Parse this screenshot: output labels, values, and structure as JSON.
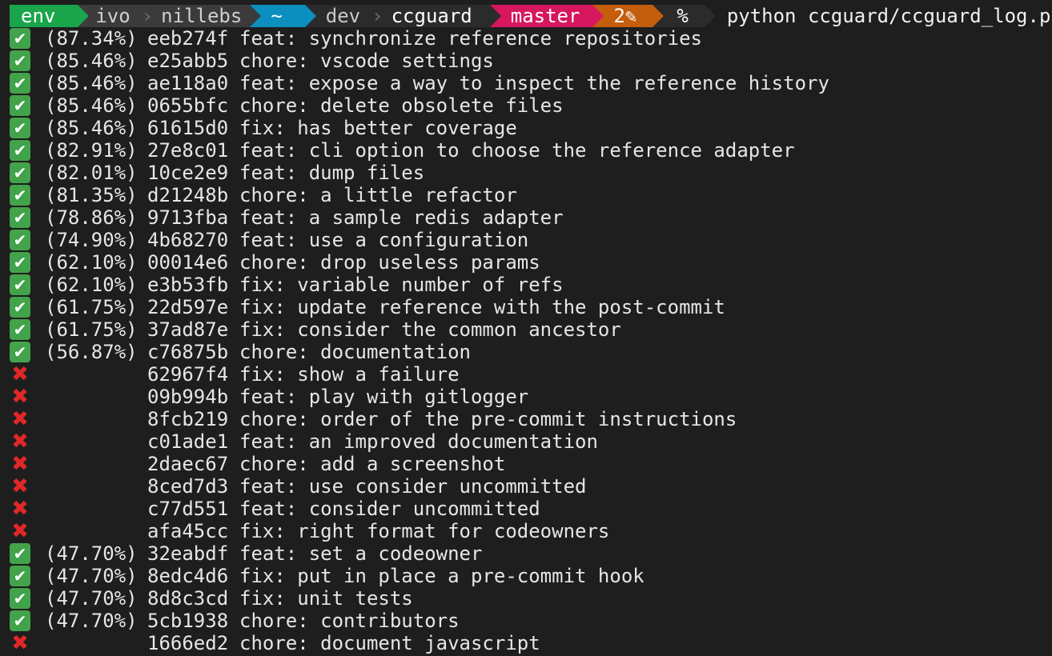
{
  "prompt": {
    "env": "env",
    "user": "ivo",
    "host": "nillebs",
    "home": "~",
    "path_parent": "dev",
    "path_current": "ccguard",
    "branch": "master",
    "changes": "2✎",
    "symbol": "%",
    "command": "python ccguard/ccguard_log.py",
    "colors": {
      "env": "#1aa54a",
      "home": "#0a8fbe",
      "branch": "#d6175d",
      "changes": "#c45d0c"
    }
  },
  "log": {
    "rows": [
      {
        "status": "pass",
        "coverage": "(87.34%)",
        "hash": "eeb274f",
        "message": "feat: synchronize reference repositories"
      },
      {
        "status": "pass",
        "coverage": "(85.46%)",
        "hash": "e25abb5",
        "message": "chore: vscode settings"
      },
      {
        "status": "pass",
        "coverage": "(85.46%)",
        "hash": "ae118a0",
        "message": "feat: expose a way to inspect the reference history"
      },
      {
        "status": "pass",
        "coverage": "(85.46%)",
        "hash": "0655bfc",
        "message": "chore: delete obsolete files"
      },
      {
        "status": "pass",
        "coverage": "(85.46%)",
        "hash": "61615d0",
        "message": "fix: has better coverage"
      },
      {
        "status": "pass",
        "coverage": "(82.91%)",
        "hash": "27e8c01",
        "message": "feat: cli option to choose the reference adapter"
      },
      {
        "status": "pass",
        "coverage": "(82.01%)",
        "hash": "10ce2e9",
        "message": "feat: dump files"
      },
      {
        "status": "pass",
        "coverage": "(81.35%)",
        "hash": "d21248b",
        "message": "chore: a little refactor"
      },
      {
        "status": "pass",
        "coverage": "(78.86%)",
        "hash": "9713fba",
        "message": "feat: a sample redis adapter"
      },
      {
        "status": "pass",
        "coverage": "(74.90%)",
        "hash": "4b68270",
        "message": "feat: use a configuration"
      },
      {
        "status": "pass",
        "coverage": "(62.10%)",
        "hash": "00014e6",
        "message": "chore: drop useless params"
      },
      {
        "status": "pass",
        "coverage": "(62.10%)",
        "hash": "e3b53fb",
        "message": "fix: variable number of refs"
      },
      {
        "status": "pass",
        "coverage": "(61.75%)",
        "hash": "22d597e",
        "message": "fix: update reference with the post-commit"
      },
      {
        "status": "pass",
        "coverage": "(61.75%)",
        "hash": "37ad87e",
        "message": "fix: consider the common ancestor"
      },
      {
        "status": "pass",
        "coverage": "(56.87%)",
        "hash": "c76875b",
        "message": "chore: documentation"
      },
      {
        "status": "fail",
        "coverage": "",
        "hash": "62967f4",
        "message": "fix: show a failure"
      },
      {
        "status": "fail",
        "coverage": "",
        "hash": "09b994b",
        "message": "feat: play with gitlogger"
      },
      {
        "status": "fail",
        "coverage": "",
        "hash": "8fcb219",
        "message": "chore: order of the pre-commit instructions"
      },
      {
        "status": "fail",
        "coverage": "",
        "hash": "c01ade1",
        "message": "feat: an improved documentation"
      },
      {
        "status": "fail",
        "coverage": "",
        "hash": "2daec67",
        "message": "chore: add a screenshot"
      },
      {
        "status": "fail",
        "coverage": "",
        "hash": "8ced7d3",
        "message": "feat: use consider uncommitted"
      },
      {
        "status": "fail",
        "coverage": "",
        "hash": "c77d551",
        "message": "feat: consider uncommitted"
      },
      {
        "status": "fail",
        "coverage": "",
        "hash": "afa45cc",
        "message": "fix: right format for codeowners"
      },
      {
        "status": "pass",
        "coverage": "(47.70%)",
        "hash": "32eabdf",
        "message": "feat: set a codeowner"
      },
      {
        "status": "pass",
        "coverage": "(47.70%)",
        "hash": "8edc4d6",
        "message": "fix: put in place a pre-commit hook"
      },
      {
        "status": "pass",
        "coverage": "(47.70%)",
        "hash": "8d8c3cd",
        "message": "fix: unit tests"
      },
      {
        "status": "pass",
        "coverage": "(47.70%)",
        "hash": "5cb1938",
        "message": "chore: contributors"
      },
      {
        "status": "fail",
        "coverage": "",
        "hash": "1666ed2",
        "message": "chore: document javascript"
      }
    ],
    "icons": {
      "pass": "check-mark-icon",
      "fail": "cross-mark-icon"
    }
  }
}
